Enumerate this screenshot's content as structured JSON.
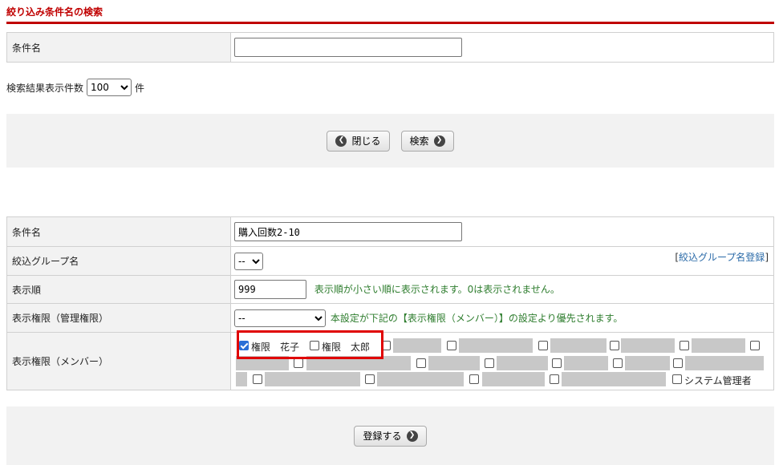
{
  "search_section": {
    "title": "絞り込み条件名の検索",
    "condition_label": "条件名",
    "condition_value": "",
    "result_count_label": "検索結果表示件数",
    "result_count_value": "100",
    "result_count_unit": "件",
    "close_button": "閉じる",
    "search_button": "検索"
  },
  "form": {
    "condition_label": "条件名",
    "condition_value": "購入回数2-10",
    "group_label": "絞込グループ名",
    "group_value": "--",
    "group_register_link": "絞込グループ名登録",
    "order_label": "表示順",
    "order_value": "999",
    "order_note": "表示順が小さい順に表示されます。0は表示されません。",
    "admin_perm_label": "表示権限（管理権限）",
    "admin_perm_value": "--",
    "admin_perm_note": "本設定が下記の【表示権限（メンバー）】の設定より優先されます。",
    "member_perm_label": "表示権限（メンバー）",
    "members": [
      {
        "name": "権限　花子",
        "checked": true
      },
      {
        "name": "権限　太郎",
        "checked": false
      }
    ],
    "system_admin_label": "システム管理者",
    "submit_button": "登録する"
  }
}
